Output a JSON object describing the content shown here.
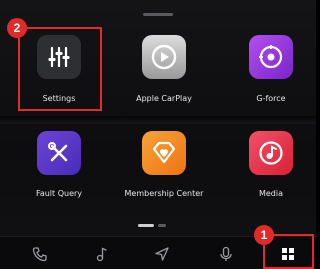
{
  "apps": [
    {
      "label": "Settings",
      "icon": "sliders-icon",
      "color": "#2e2f33"
    },
    {
      "label": "Apple CarPlay",
      "icon": "carplay-icon",
      "color": "#c9c9c9"
    },
    {
      "label": "G-force",
      "icon": "g-force-icon",
      "color": "#9b3be0"
    },
    {
      "label": "Fault Query",
      "icon": "wrench-screwdriver-icon",
      "color": "#5b35c9"
    },
    {
      "label": "Membership Center",
      "icon": "diamond-heart-icon",
      "color": "#f08a1c"
    },
    {
      "label": "Media",
      "icon": "music-note-icon",
      "color": "#e8344a"
    }
  ],
  "dock": {
    "items": [
      "phone-icon",
      "music-icon",
      "navigation-icon",
      "microphone-icon",
      "app-grid-icon"
    ]
  },
  "callouts": {
    "settings_number": "2",
    "app_grid_number": "1",
    "color": "#e12a2a"
  },
  "page_indicator": {
    "pages": 2,
    "active": 1
  }
}
